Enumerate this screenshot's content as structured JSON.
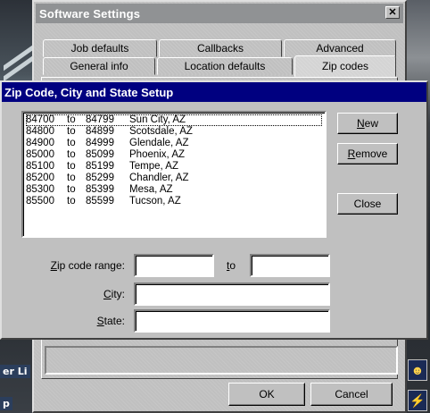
{
  "outer_window": {
    "title": "Software Settings",
    "close_glyph": "✕",
    "tabs_back": [
      "Job defaults",
      "Callbacks",
      "Advanced"
    ],
    "tabs_front": [
      "General info",
      "Location defaults",
      "Zip codes"
    ],
    "ok_label": "OK",
    "cancel_label": "Cancel"
  },
  "background": {
    "left_text_1": "er Li",
    "left_text_2": "p"
  },
  "dialog": {
    "title": "Zip Code, City and State Setup",
    "rows": [
      {
        "from": "84700",
        "to_word": "to",
        "to": "84799",
        "city": "Sun City, AZ"
      },
      {
        "from": "84800",
        "to_word": "to",
        "to": "84899",
        "city": "Scotsdale, AZ"
      },
      {
        "from": "84900",
        "to_word": "to",
        "to": "84999",
        "city": "Glendale, AZ"
      },
      {
        "from": "85000",
        "to_word": "to",
        "to": "85099",
        "city": "Phoenix, AZ"
      },
      {
        "from": "85100",
        "to_word": "to",
        "to": "85199",
        "city": "Tempe, AZ"
      },
      {
        "from": "85200",
        "to_word": "to",
        "to": "85299",
        "city": "Chandler, AZ"
      },
      {
        "from": "85300",
        "to_word": "to",
        "to": "85399",
        "city": "Mesa, AZ"
      },
      {
        "from": "85500",
        "to_word": "to",
        "to": "85599",
        "city": "Tucson, AZ"
      }
    ],
    "buttons": {
      "new": {
        "accel": "N",
        "rest": "ew"
      },
      "remove": {
        "accel": "R",
        "rest": "emove"
      },
      "close": "Close"
    },
    "labels": {
      "zip_range": {
        "accel": "Z",
        "rest": "ip code range:"
      },
      "to": {
        "accel": "t",
        "rest": "o"
      },
      "city": {
        "accel": "C",
        "rest": "ity:"
      },
      "state": {
        "accel": "S",
        "rest": "tate:"
      }
    },
    "fields": {
      "zip_from": "",
      "zip_to": "",
      "city": "",
      "state": ""
    }
  },
  "colors": {
    "dialog_title_bg": "#000080",
    "face": "#c0c0c0"
  }
}
